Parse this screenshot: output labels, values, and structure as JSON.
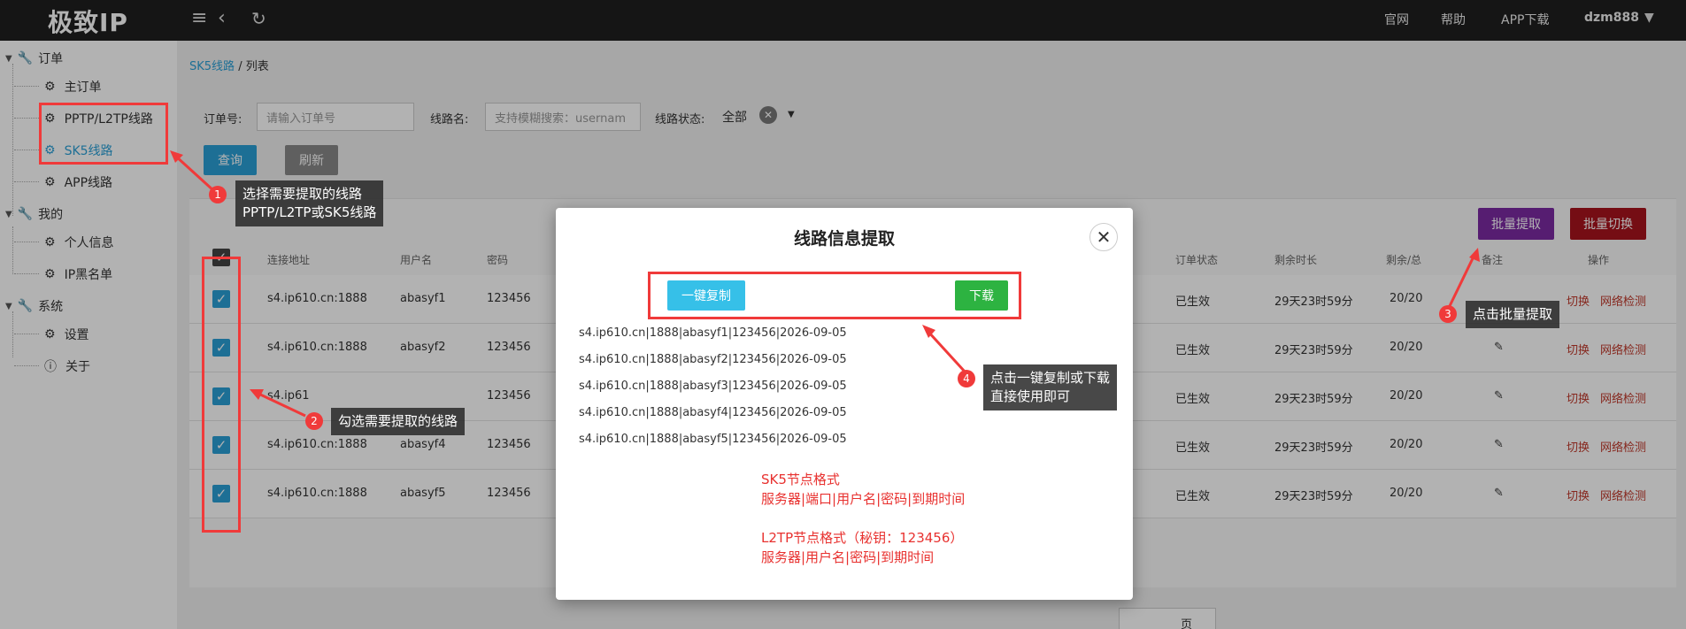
{
  "topbar": {
    "logo": "极致IP",
    "links": [
      "官网",
      "帮助",
      "APP下载"
    ],
    "user": "dzm888"
  },
  "sidebar": {
    "groups": [
      {
        "label": "订单",
        "items": [
          "主订单",
          "PPTP/L2TP线路",
          "SK5线路",
          "APP线路"
        ]
      },
      {
        "label": "我的",
        "items": [
          "个人信息",
          "IP黑名单"
        ]
      },
      {
        "label": "系统",
        "items": [
          "设置",
          "关于"
        ]
      }
    ]
  },
  "breadcrumb": {
    "parent": "SK5线路",
    "sep": "/",
    "current": "列表"
  },
  "filters": {
    "order_label": "订单号:",
    "order_placeholder": "请输入订单号",
    "line_label": "线路名:",
    "line_placeholder": "支持模糊搜索：usernam",
    "status_label": "线路状态:",
    "status_value": "全部",
    "query": "查询",
    "refresh": "刷新"
  },
  "actions": {
    "batch_extract": "批量提取",
    "batch_switch": "批量切换"
  },
  "table": {
    "headers": [
      "连接地址",
      "用户名",
      "密码",
      "订单状态",
      "剩余时长",
      "剩余/总",
      "备注",
      "操作"
    ],
    "rows": [
      {
        "addr": "s4.ip610.cn:1888",
        "user": "abasyf1",
        "pwd": "123456",
        "status": "已生效",
        "remain": "29天23时59分",
        "count": "20/20"
      },
      {
        "addr": "s4.ip610.cn:1888",
        "user": "abasyf2",
        "pwd": "123456",
        "status": "已生效",
        "remain": "29天23时59分",
        "count": "20/20"
      },
      {
        "addr": "s4.ip61",
        "user": "",
        "pwd": "123456",
        "status": "已生效",
        "remain": "29天23时59分",
        "count": "20/20"
      },
      {
        "addr": "s4.ip610.cn:1888",
        "user": "abasyf4",
        "pwd": "123456",
        "status": "已生效",
        "remain": "29天23时59分",
        "count": "20/20"
      },
      {
        "addr": "s4.ip610.cn:1888",
        "user": "abasyf5",
        "pwd": "123456",
        "status": "已生效",
        "remain": "29天23时59分",
        "count": "20/20"
      }
    ],
    "op_switch": "切换",
    "op_check": "网络检测",
    "page_label": "页"
  },
  "modal": {
    "title": "线路信息提取",
    "copy": "一键复制",
    "download": "下载",
    "lines": [
      "s4.ip610.cn|1888|abasyf1|123456|2026-09-05",
      "s4.ip610.cn|1888|abasyf2|123456|2026-09-05",
      "s4.ip610.cn|1888|abasyf3|123456|2026-09-05",
      "s4.ip610.cn|1888|abasyf4|123456|2026-09-05",
      "s4.ip610.cn|1888|abasyf5|123456|2026-09-05"
    ],
    "note1_title": "SK5节点格式",
    "note1_body": "服务器|端口|用户名|密码|到期时间",
    "note2_title": "L2TP节点格式（秘钥：123456）",
    "note2_body": "服务器|用户名|密码|到期时间"
  },
  "annotations": {
    "c1_num": "1",
    "c1_line1": "选择需要提取的线路",
    "c1_line2": "PPTP/L2TP或SK5线路",
    "c2_num": "2",
    "c2_text": "勾选需要提取的线路",
    "c3_num": "3",
    "c3_text": "点击批量提取",
    "c4_num": "4",
    "c4_line1": "点击一键复制或下载",
    "c4_line2": "直接使用即可"
  },
  "colors": {
    "accent": "#2a9fd6",
    "annotation": "#f03a3a",
    "batch_extract": "#7b2aa3",
    "batch_switch": "#a8141e"
  }
}
